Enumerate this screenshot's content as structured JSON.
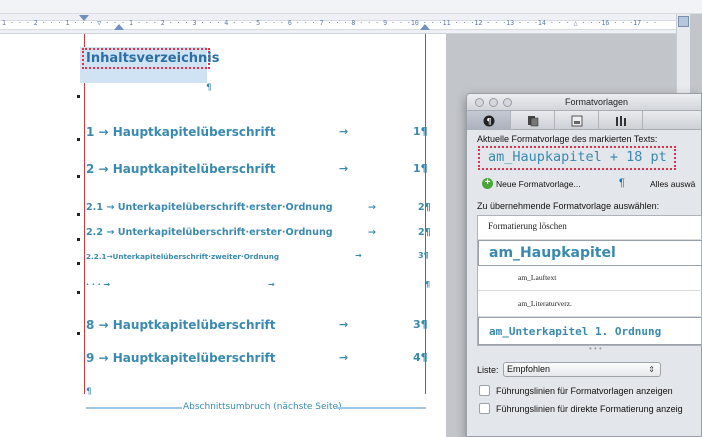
{
  "ruler": {
    "numbers": "1 · · · 2 · · · 1 · · · ▽ · · · 1 · · · 2 · · · 3 · · · 4 · · · 5 · · · 6 · · · 7 · · · 8 · · · 9 · · ·10 · · ·11 · · ·12 · · ·13 · · ·14 · · · △ · · ·16 · · ·17 · ·"
  },
  "document": {
    "heading": "Inhaltsverzeichnis",
    "heading_pilcrow": "¶",
    "entries": [
      {
        "text": "1 → Hauptkapitelüberschrift",
        "tab": "→",
        "page": "1¶"
      },
      {
        "text": "2 → Hauptkapitelüberschrift",
        "tab": "→",
        "page": "1¶"
      },
      {
        "text": "2.1 → Unterkapitelüberschrift·erster·Ordnung",
        "tab": "→",
        "page": "2¶"
      },
      {
        "text": "2.2 → Unterkapitelüberschrift·erster·Ordnung",
        "tab": "→",
        "page": "2¶"
      },
      {
        "text": "2.2.1→Unterkapitelüberschrift·zweiter·Ordnung",
        "tab": "→",
        "page": "3¶"
      },
      {
        "text": "· · · →",
        "tab": "→",
        "page": "¶"
      },
      {
        "text": "8 → Hauptkapitelüberschrift",
        "tab": "→",
        "page": "3¶"
      },
      {
        "text": "9 → Hauptkapitelüberschrift",
        "tab": "→",
        "page": "4¶"
      }
    ],
    "end_pilcrow": "¶",
    "section_break": "Abschnittsumbruch (nächste Seite)"
  },
  "panel": {
    "title": "Formatvorlagen",
    "tabs": [
      "pilcrow-icon",
      "copy-icon",
      "document-icon",
      "columns-icon"
    ],
    "current_label": "Aktuelle Formatvorlage des markierten Texts:",
    "current_value": "am_Haupkapitel + 18 pt",
    "new_style_label": "Neue Formatvorlage...",
    "select_all_label": "Alles auswä",
    "apply_label": "Zu übernehmende Formatvorlage auswählen:",
    "styles": [
      "Formatierung löschen",
      "am_Haupkapitel",
      "am_Lauftext",
      "am_Literaturverz.",
      "am_Unterkapitel 1. Ordnung"
    ],
    "ellipsis": "• • •",
    "list_label": "Liste:",
    "list_value": "Empfohlen",
    "checkbox_1": "Führungslinien für Formatvorlagen anzeigen",
    "checkbox_2": "Führungslinien für direkte Formatierung anzeig"
  },
  "colors": {
    "accent": "#3a8ab0",
    "highlight_dots": "#e0304a",
    "margin_line": "#d03a3a"
  }
}
